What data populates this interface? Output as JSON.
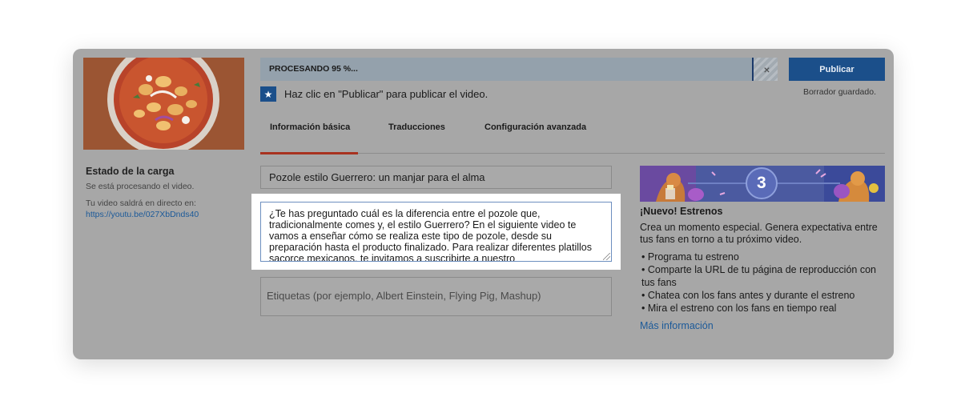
{
  "upload": {
    "title": "Estado de la carga",
    "status": "Se está procesando el video.",
    "live_text": "Tu video saldrá en directo en:",
    "live_url": "https://youtu.be/027XbDnds40"
  },
  "progress": {
    "label": "PROCESANDO 95 %...",
    "percent": 95,
    "cancel_glyph": "×"
  },
  "header": {
    "publish_label": "Publicar",
    "draft_status": "Borrador guardado.",
    "hint_text": "Haz clic en \"Publicar\" para publicar el video."
  },
  "tabs": [
    {
      "label": "Información básica",
      "active": true
    },
    {
      "label": "Traducciones",
      "active": false
    },
    {
      "label": "Configuración avanzada",
      "active": false
    }
  ],
  "form": {
    "title_value": "Pozole estilo Guerrero: un manjar para el alma",
    "description_value": "¿Te has preguntado cuál es la diferencia entre el pozole que, tradicionalmente comes y, el estilo Guerrero? En el siguiente video te vamos a enseñar cómo se realiza este tipo de pozole, desde su preparación hasta el producto finalizado. Para realizar diferentes platillos sacorce mexicanos, te invitamos a suscribirte a nuestro",
    "tags_placeholder": "Etiquetas (por ejemplo, Albert Einstein, Flying Pig, Mashup)"
  },
  "promo": {
    "banner_number": "3",
    "title": "¡Nuevo! Estrenos",
    "body": "Crea un momento especial. Genera expectativa entre tus fans en torno a tu próximo video.",
    "items": [
      "Programa tu estreno",
      "Comparte la URL de tu página de reproducción con tus fans",
      "Chatea con los fans antes y durante el estreno",
      "Mira el estreno con los fans en tiempo real"
    ],
    "link": "Más información"
  },
  "colors": {
    "overlay": "#a7a7a7",
    "accent_blue": "#1b4f8a",
    "tab_underline": "#a8321f",
    "link": "#1c5a99"
  },
  "icons": {
    "hint": "star-icon",
    "cancel": "close-icon",
    "resize": "resize-grip-icon"
  }
}
